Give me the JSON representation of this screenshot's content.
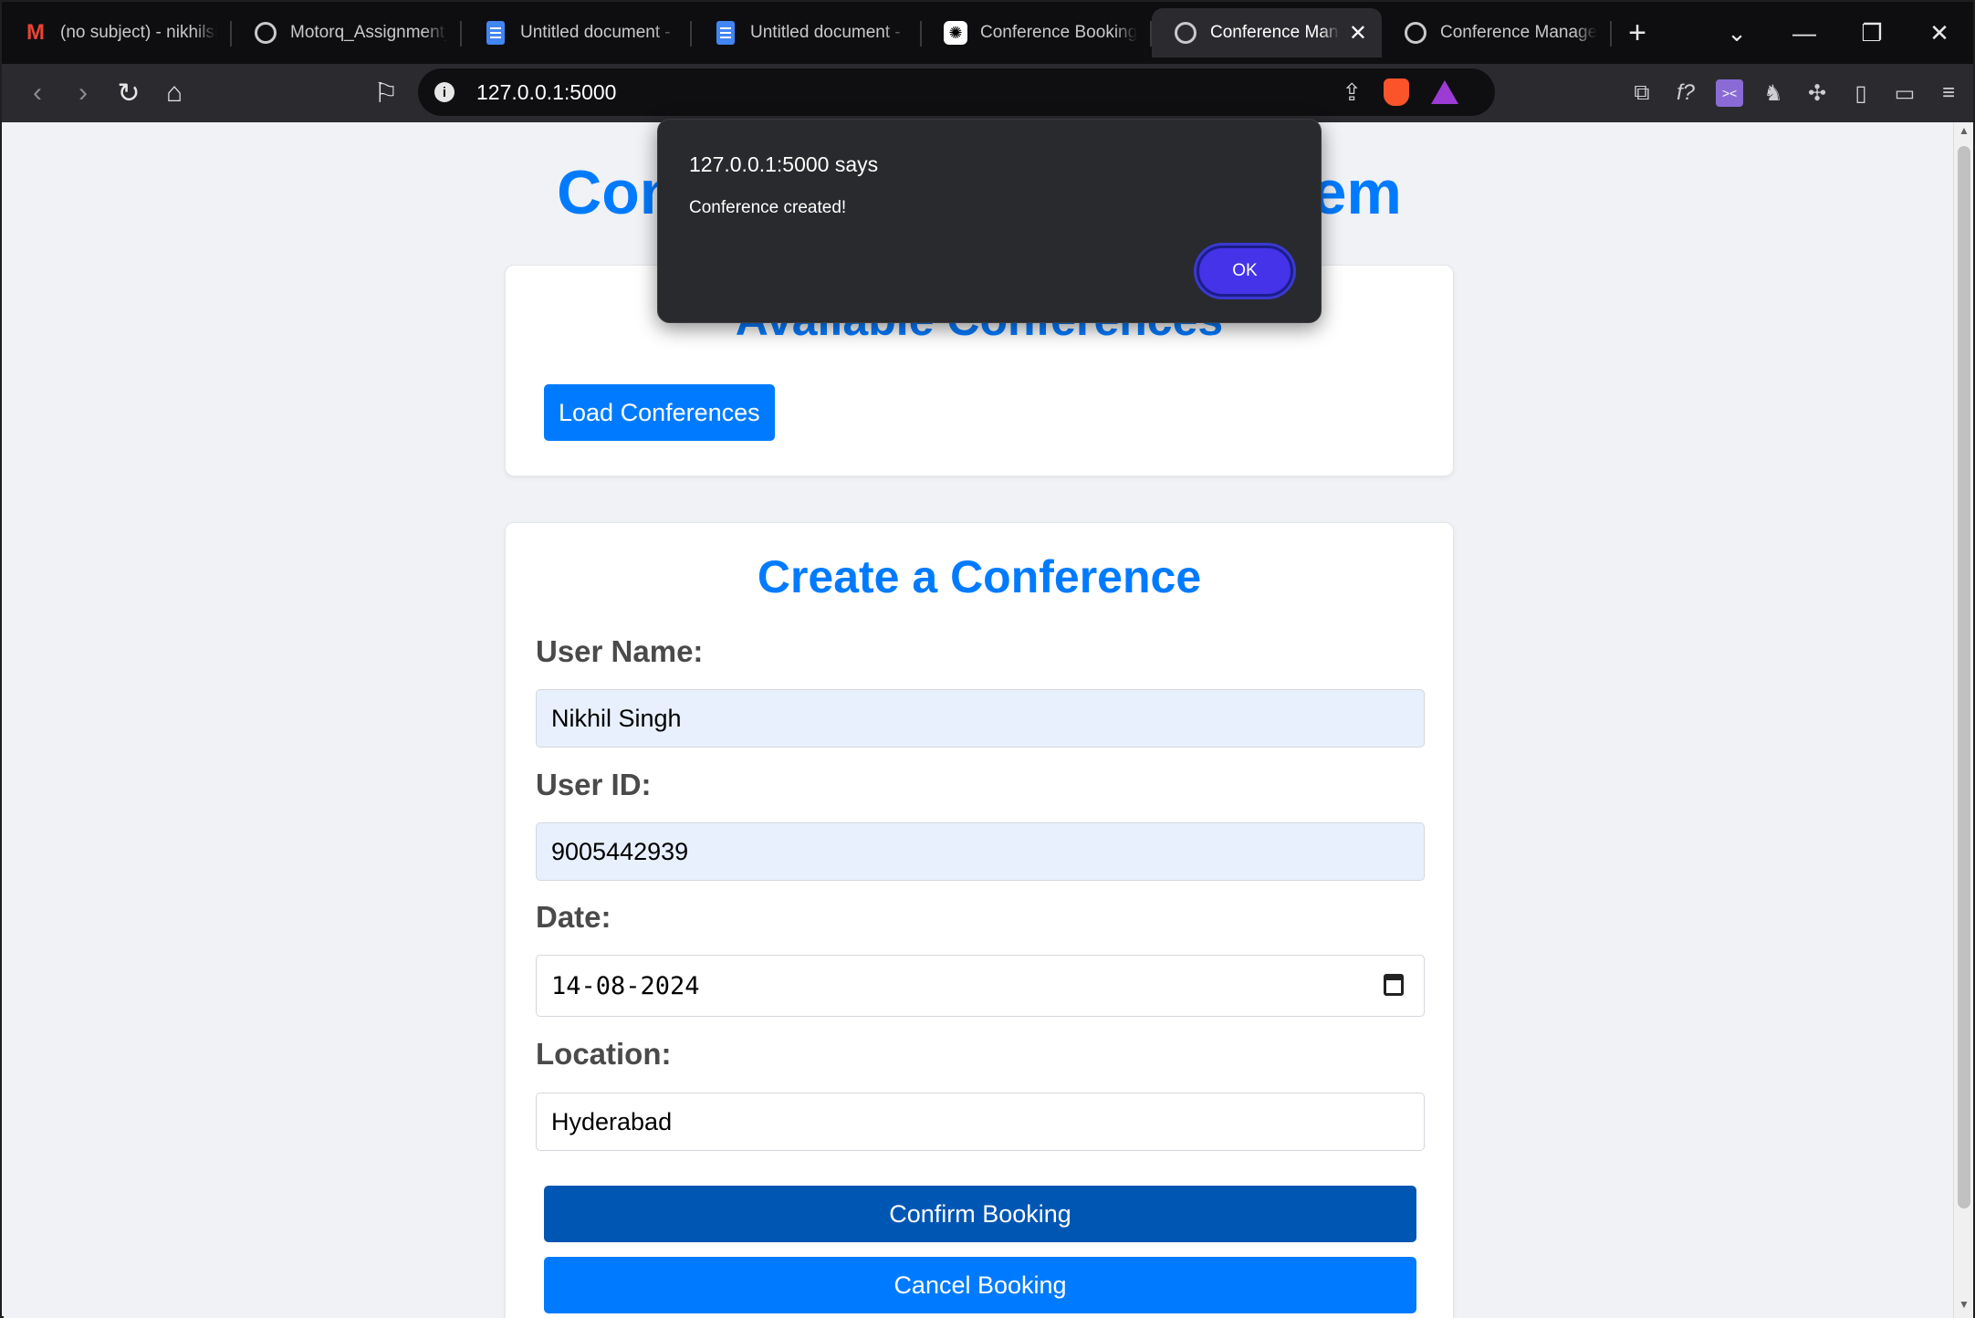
{
  "browser": {
    "tabs": [
      {
        "title": "(no subject) - nikhilsin",
        "icon": "gmail-icon",
        "active": false
      },
      {
        "title": "Motorq_Assignment_F",
        "icon": "globe-icon",
        "active": false
      },
      {
        "title": "Untitled document - G",
        "icon": "docs-icon",
        "active": false
      },
      {
        "title": "Untitled document - G",
        "icon": "docs-icon",
        "active": false
      },
      {
        "title": "Conference Booking A",
        "icon": "chatgpt-icon",
        "active": false
      },
      {
        "title": "Conference Man",
        "icon": "globe-icon",
        "active": true
      },
      {
        "title": "Conference Managem",
        "icon": "globe-icon",
        "active": false
      }
    ],
    "new_tab_glyph": "+",
    "address": "127.0.0.1:5000"
  },
  "page": {
    "title": "Conference Booking System",
    "available_section": {
      "heading": "Available Conferences",
      "load_button": "Load Conferences"
    },
    "create_section": {
      "heading": "Create a Conference",
      "user_name_label": "User Name:",
      "user_name_value": "Nikhil Singh",
      "user_id_label": "User ID:",
      "user_id_value": "9005442939",
      "date_label": "Date:",
      "date_value": "14-08-2024",
      "location_label": "Location:",
      "location_value": "Hyderabad",
      "confirm_button": "Confirm Booking",
      "cancel_button": "Cancel Booking"
    }
  },
  "dialog": {
    "title": "127.0.0.1:5000 says",
    "message": "Conference created!",
    "ok_label": "OK"
  },
  "colors": {
    "accent": "#007bff",
    "accent_dark": "#0056b3",
    "dialog_button": "#4433e8",
    "autofill_bg": "#e8f0fe"
  }
}
